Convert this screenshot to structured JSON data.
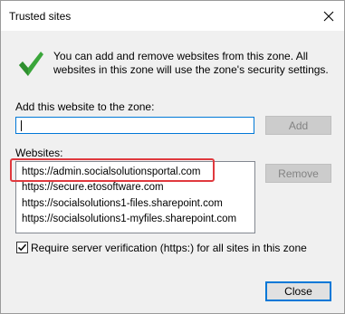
{
  "dialog": {
    "title": "Trusted sites",
    "info": "You can add and remove websites from this zone. All websites in this zone will use the zone's security settings.",
    "add_label": "Add this website to the zone:",
    "add_value": "",
    "add_button": "Add",
    "websites_label": "Websites:",
    "websites": [
      "https://admin.socialsolutionsportal.com",
      "https://secure.etosoftware.com",
      "https://socialsolutions1-files.sharepoint.com",
      "https://socialsolutions1-myfiles.sharepoint.com"
    ],
    "remove_button": "Remove",
    "require_https_label": "Require server verification (https:) for all sites in this zone",
    "require_https_checked": true,
    "close_button": "Close"
  },
  "colors": {
    "highlight_border": "#e0393e",
    "check_green": "#3aa63a",
    "focus_blue": "#0078d7"
  },
  "icons": {
    "close": "close-icon",
    "check": "checkmark-icon",
    "checkbox": "checkbox-checked-icon"
  }
}
